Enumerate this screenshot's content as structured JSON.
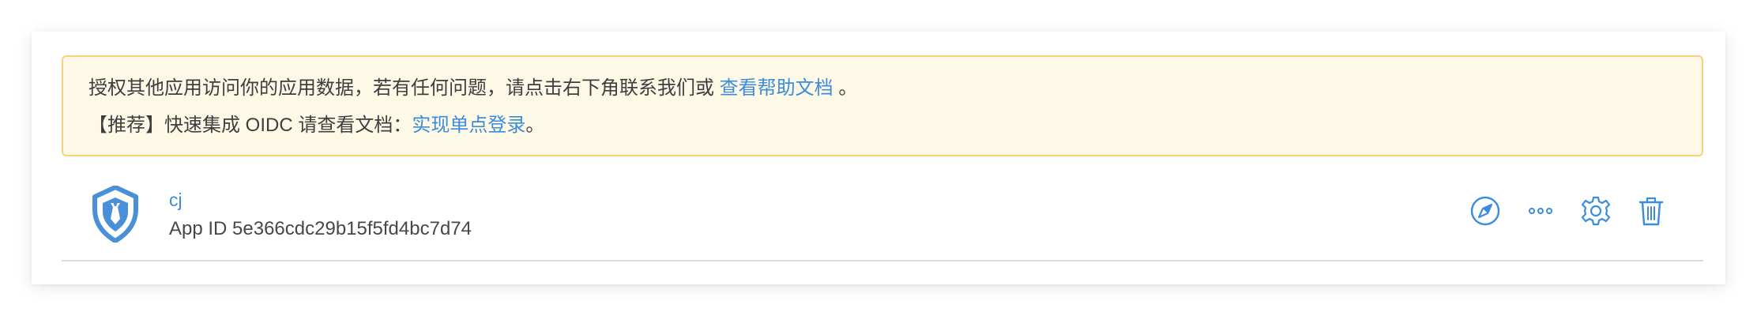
{
  "notice": {
    "line1_text": "授权其他应用访问你的应用数据，若有任何问题，请点击右下角联系我们或",
    "line1_link": "查看帮助文档",
    "line1_suffix": " 。",
    "line2_text": "【推荐】快速集成 OIDC 请查看文档：",
    "line2_link": "实现单点登录",
    "line2_suffix": "。"
  },
  "app": {
    "name": "cj",
    "id_label": "App ID 5e366cdc29b15f5fd4bc7d74",
    "logo_icon": "shield-tie-icon"
  },
  "actions": [
    {
      "icon": "compass-icon"
    },
    {
      "icon": "more-icon"
    },
    {
      "icon": "gear-icon"
    },
    {
      "icon": "trash-icon"
    }
  ],
  "colors": {
    "accent": "#3c8cdc",
    "notice_bg": "#fef8e6",
    "notice_border": "#f6d37b"
  }
}
